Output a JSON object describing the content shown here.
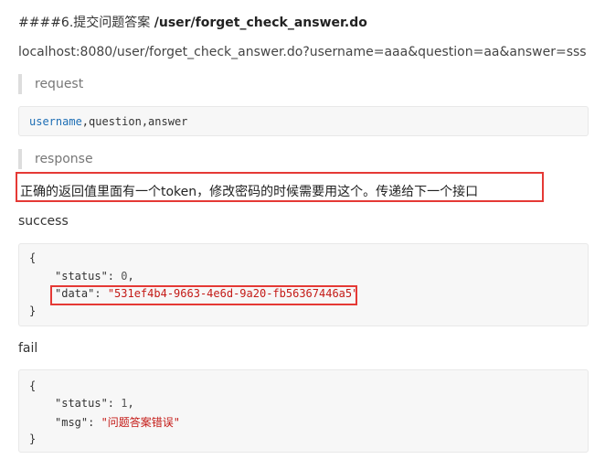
{
  "heading": {
    "prefix": "####6.提交问题答案 ",
    "path": "/user/forget_check_answer.do"
  },
  "url": "localhost:8080/user/forget_check_answer.do?username=aaa&question=aa&answer=sss",
  "request_label": "request",
  "request_params": {
    "first": "username",
    "rest": ",question,answer"
  },
  "response_label": "response",
  "note": "正确的返回值里面有一个token，修改密码的时候需要用这个。传递给下一个接口",
  "success_label": "success",
  "success_code": {
    "open": "{",
    "status_key": "\"status\"",
    "status_sep": ": ",
    "status_val": "0",
    "comma": ",",
    "data_key": "\"data\"",
    "data_sep": ": ",
    "data_val": "\"531ef4b4-9663-4e6d-9a20-fb56367446a5\"",
    "close": "}"
  },
  "fail_label": "fail",
  "fail_code": {
    "open": "{",
    "status_key": "\"status\"",
    "status_sep": ": ",
    "status_val": "1",
    "comma": ",",
    "msg_key": "\"msg\"",
    "msg_sep": ": ",
    "msg_val": "\"问题答案错误\"",
    "close": "}"
  },
  "colors": {
    "highlight_border": "#e53935",
    "code_background": "#f7f7f7",
    "string_color": "#c41a16",
    "keyword_color": "#1f6fb5"
  }
}
